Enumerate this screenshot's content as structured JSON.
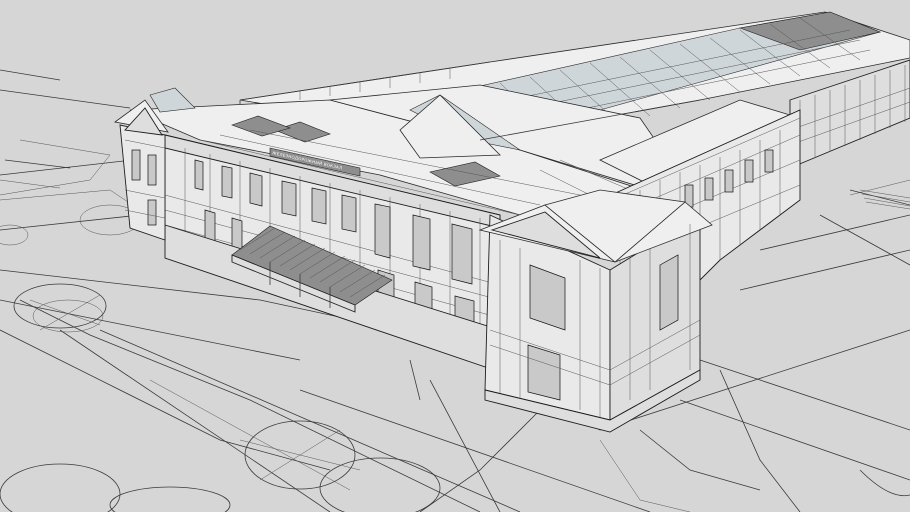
{
  "scene": {
    "sign_text": "ЖЕЛЕЗНОДОРОЖНЫЙ ВОКЗАЛ",
    "background_color": "#d6d6d6",
    "line_color": "#3a3a3a"
  }
}
